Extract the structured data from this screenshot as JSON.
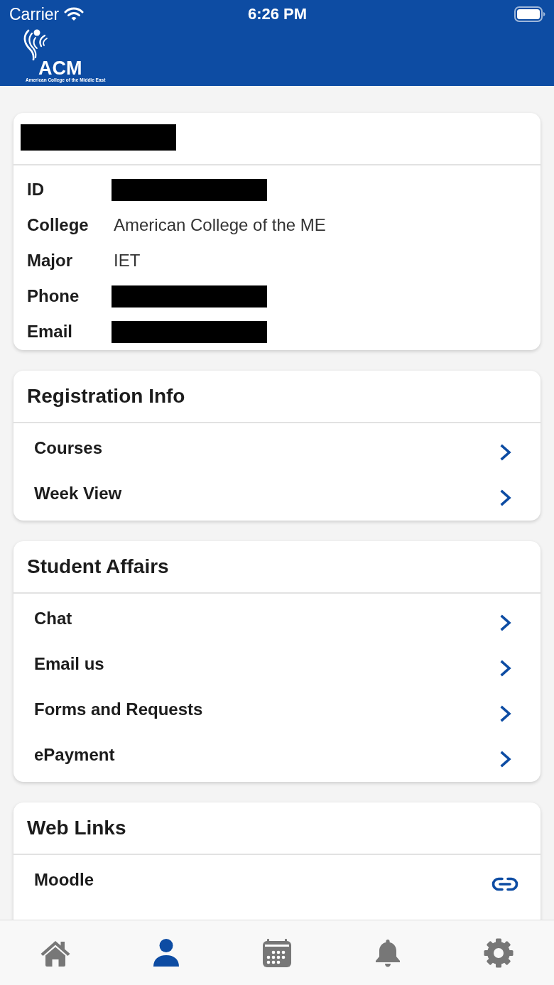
{
  "status_bar": {
    "carrier": "Carrier",
    "time": "6:26 PM"
  },
  "header": {
    "logo_text": "ACM",
    "logo_subtitle": "American College of the Middle East"
  },
  "profile": {
    "name_redacted": true,
    "fields": [
      {
        "label": "ID",
        "redacted": true
      },
      {
        "label": "College",
        "value": "American College of the ME",
        "redacted": false
      },
      {
        "label": "Major",
        "value": "IET",
        "redacted": false
      },
      {
        "label": "Phone",
        "redacted": true
      },
      {
        "label": "Email",
        "redacted": true
      }
    ]
  },
  "sections": [
    {
      "title": "Registration Info",
      "rows": [
        {
          "label": "Courses",
          "kind": "nav"
        },
        {
          "label": "Week View",
          "kind": "nav"
        }
      ]
    },
    {
      "title": "Student Affairs",
      "rows": [
        {
          "label": "Chat",
          "kind": "nav"
        },
        {
          "label": "Email us",
          "kind": "nav"
        },
        {
          "label": "Forms and Requests",
          "kind": "nav"
        },
        {
          "label": "ePayment",
          "kind": "nav"
        }
      ]
    },
    {
      "title": "Web Links",
      "rows": [
        {
          "label": "Moodle",
          "kind": "link"
        }
      ]
    }
  ],
  "tab_bar": {
    "tabs": [
      {
        "kind": "home",
        "selected": false
      },
      {
        "kind": "profile",
        "selected": true
      },
      {
        "kind": "calendar",
        "selected": false
      },
      {
        "kind": "notifications",
        "selected": false
      },
      {
        "kind": "settings",
        "selected": false
      }
    ]
  }
}
